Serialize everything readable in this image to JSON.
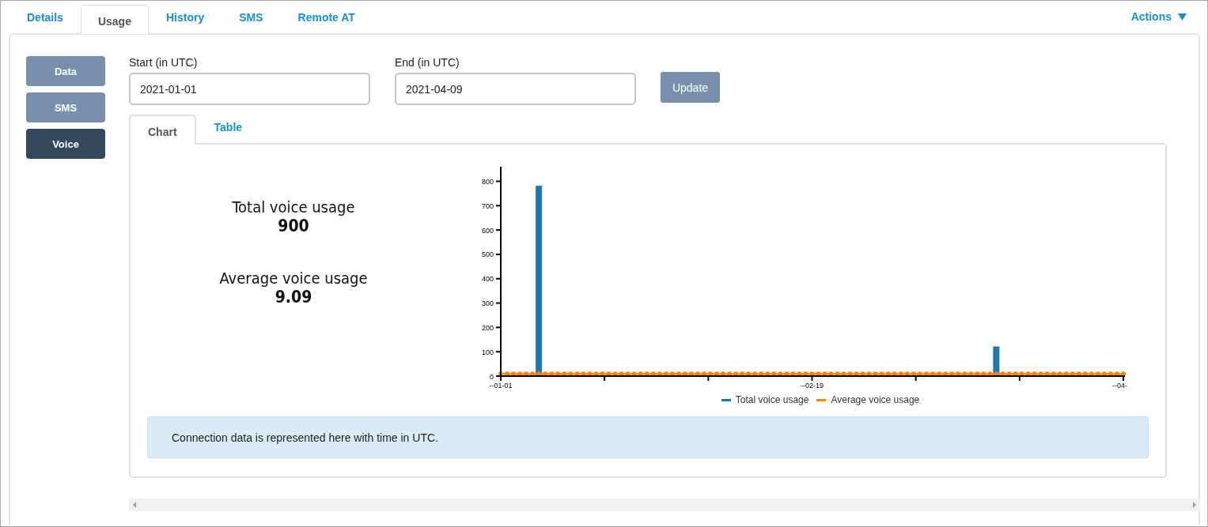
{
  "tabs": [
    {
      "label": "Details",
      "selected": false
    },
    {
      "label": "Usage",
      "selected": true
    },
    {
      "label": "History",
      "selected": false
    },
    {
      "label": "SMS",
      "selected": false
    },
    {
      "label": "Remote AT",
      "selected": false
    }
  ],
  "actions": {
    "label": "Actions"
  },
  "sidebar": {
    "items": [
      {
        "label": "Data",
        "selected": false
      },
      {
        "label": "SMS",
        "selected": false
      },
      {
        "label": "Voice",
        "selected": true
      }
    ]
  },
  "form": {
    "start": {
      "label": "Start (in UTC)",
      "value": "2021-01-01"
    },
    "end": {
      "label": "End (in UTC)",
      "value": "2021-04-09"
    },
    "update_button": "Update"
  },
  "view_tabs": [
    {
      "label": "Chart",
      "selected": true
    },
    {
      "label": "Table",
      "selected": false
    }
  ],
  "stats": [
    {
      "label": "Total voice usage",
      "value": "900"
    },
    {
      "label": "Average voice usage",
      "value": "9.09"
    }
  ],
  "chart_data": {
    "type": "bar",
    "categories": [
      "--01-01",
      null,
      null,
      null,
      null,
      null,
      null,
      null,
      null,
      null,
      null,
      null,
      null,
      null,
      null,
      null,
      null,
      null,
      null,
      null,
      null,
      null,
      null,
      null,
      null,
      null,
      null,
      null,
      null,
      null,
      null,
      null,
      null,
      null,
      null,
      null,
      null,
      null,
      null,
      null,
      null,
      null,
      null,
      null,
      null,
      null,
      null,
      null,
      null,
      "--02-19",
      null,
      null,
      null,
      null,
      null,
      null,
      null,
      null,
      null,
      null,
      null,
      null,
      null,
      null,
      null,
      null,
      null,
      null,
      null,
      null,
      null,
      null,
      null,
      null,
      null,
      null,
      null,
      null,
      null,
      null,
      null,
      null,
      null,
      null,
      null,
      null,
      null,
      null,
      null,
      null,
      null,
      null,
      null,
      null,
      null,
      null,
      null,
      null,
      "--04-"
    ],
    "series": [
      {
        "name": "Total voice usage",
        "type": "bar",
        "color": "#1f77b4",
        "values": [
          0,
          0,
          0,
          0,
          0,
          0,
          780,
          0,
          0,
          0,
          0,
          0,
          0,
          0,
          0,
          0,
          0,
          0,
          0,
          0,
          0,
          0,
          0,
          0,
          0,
          0,
          0,
          0,
          0,
          0,
          0,
          0,
          0,
          0,
          0,
          0,
          0,
          0,
          0,
          0,
          0,
          0,
          0,
          0,
          0,
          0,
          0,
          0,
          0,
          0,
          0,
          0,
          0,
          0,
          0,
          0,
          0,
          0,
          0,
          0,
          0,
          0,
          0,
          0,
          0,
          0,
          0,
          0,
          0,
          0,
          0,
          0,
          0,
          0,
          0,
          0,
          0,
          0,
          120,
          0,
          0,
          0,
          0,
          0,
          0,
          0,
          0,
          0,
          0,
          0,
          0,
          0,
          0,
          0,
          0,
          0,
          0,
          0,
          0
        ]
      },
      {
        "name": "Average voice usage",
        "type": "line",
        "marker": true,
        "color": "#ff7f0e",
        "values": [
          9.09,
          9.09,
          9.09,
          9.09,
          9.09,
          9.09,
          9.09,
          9.09,
          9.09,
          9.09,
          9.09,
          9.09,
          9.09,
          9.09,
          9.09,
          9.09,
          9.09,
          9.09,
          9.09,
          9.09,
          9.09,
          9.09,
          9.09,
          9.09,
          9.09,
          9.09,
          9.09,
          9.09,
          9.09,
          9.09,
          9.09,
          9.09,
          9.09,
          9.09,
          9.09,
          9.09,
          9.09,
          9.09,
          9.09,
          9.09,
          9.09,
          9.09,
          9.09,
          9.09,
          9.09,
          9.09,
          9.09,
          9.09,
          9.09,
          9.09,
          9.09,
          9.09,
          9.09,
          9.09,
          9.09,
          9.09,
          9.09,
          9.09,
          9.09,
          9.09,
          9.09,
          9.09,
          9.09,
          9.09,
          9.09,
          9.09,
          9.09,
          9.09,
          9.09,
          9.09,
          9.09,
          9.09,
          9.09,
          9.09,
          9.09,
          9.09,
          9.09,
          9.09,
          9.09,
          9.09,
          9.09,
          9.09,
          9.09,
          9.09,
          9.09,
          9.09,
          9.09,
          9.09,
          9.09,
          9.09,
          9.09,
          9.09,
          9.09,
          9.09,
          9.09,
          9.09,
          9.09,
          9.09,
          9.09
        ]
      }
    ],
    "legend": true,
    "ylim": [
      0,
      860
    ],
    "yticks": [
      0,
      100,
      200,
      300,
      400,
      500,
      600,
      700,
      800
    ]
  },
  "info": "Connection data is represented here with time in UTC."
}
